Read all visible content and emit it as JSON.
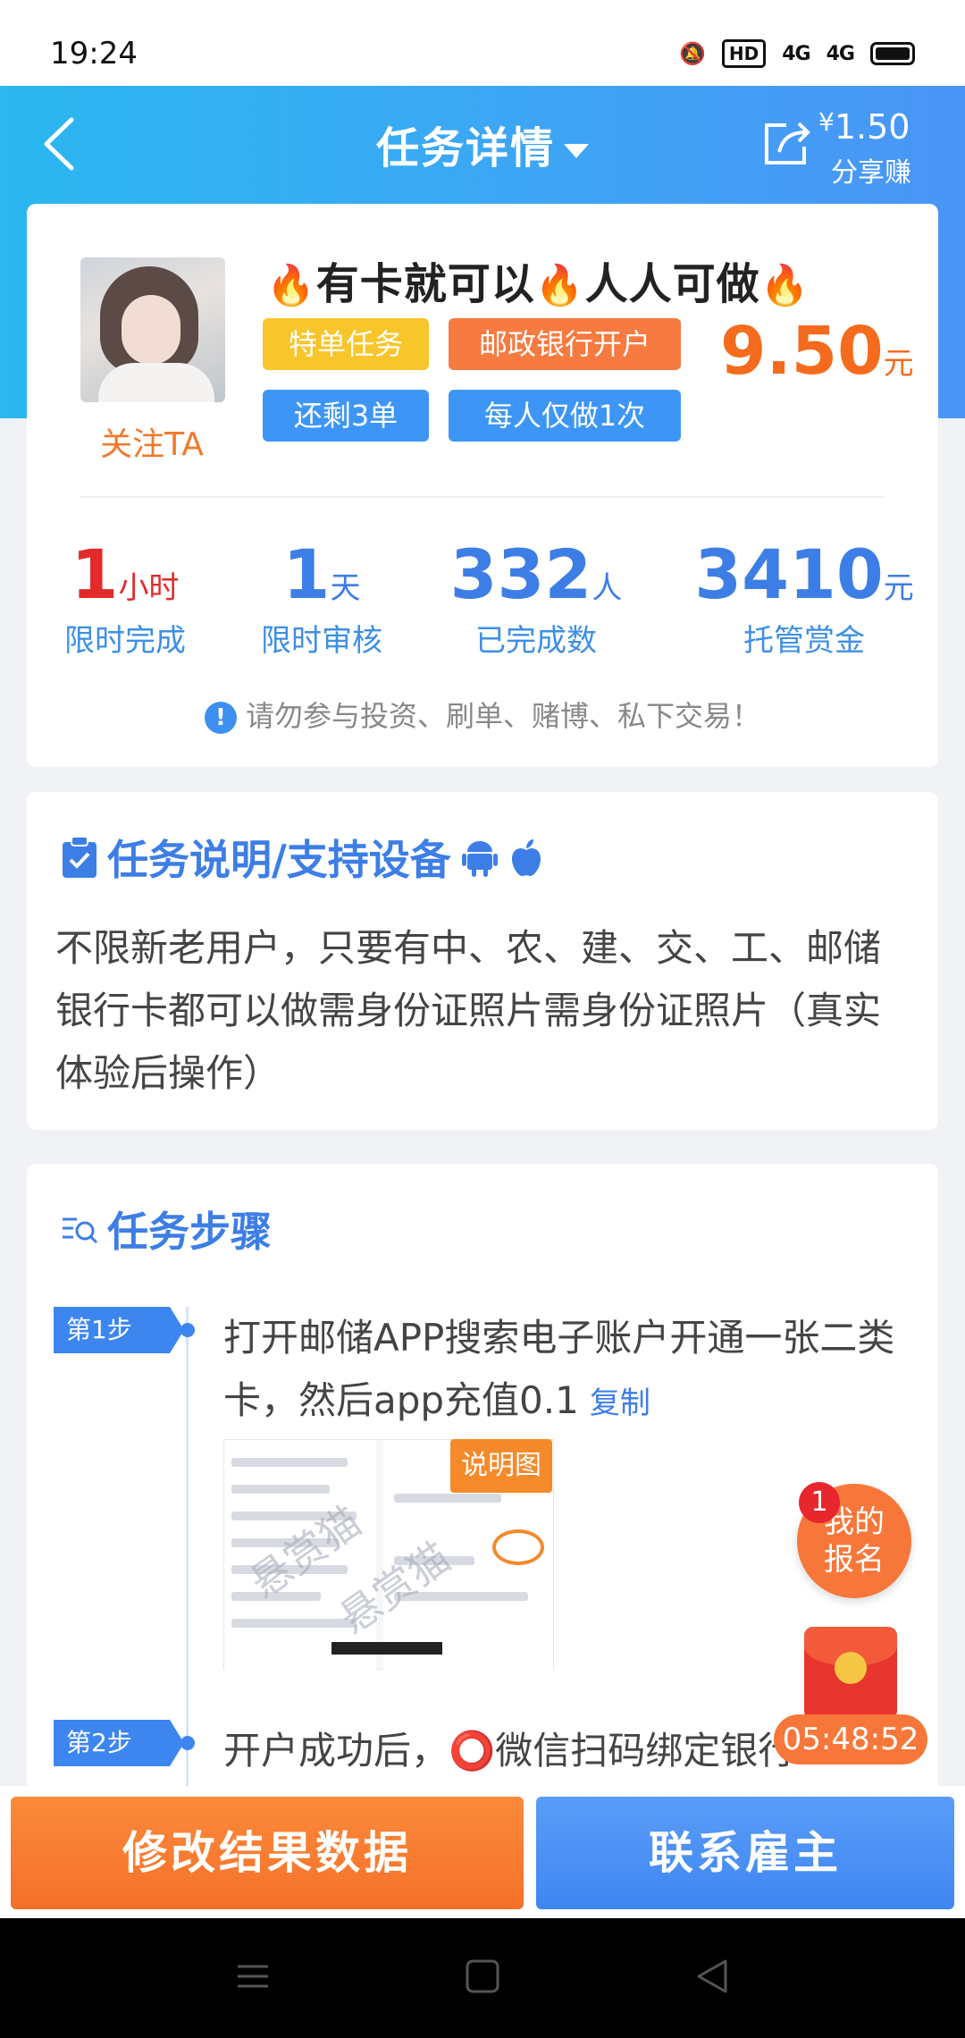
{
  "status_bar": {
    "time": "19:24",
    "hd_label": "HD",
    "net1": "4G",
    "net2": "4G"
  },
  "nav": {
    "title": "任务详情",
    "share_currency": "¥",
    "share_amount": "1.50",
    "share_label": "分享赚"
  },
  "task": {
    "follow_label": "关注TA",
    "title_part1": "有卡就可以",
    "title_part2": "人人可做",
    "tags": [
      "特单任务",
      "邮政银行开户",
      "还剩3单",
      "每人仅做1次"
    ],
    "price": "9.50",
    "price_unit": "元",
    "stats": [
      {
        "value": "1",
        "unit": "小时",
        "label": "限时完成"
      },
      {
        "value": "1",
        "unit": "天",
        "label": "限时审核"
      },
      {
        "value": "332",
        "unit": "人",
        "label": "已完成数"
      },
      {
        "value": "3410",
        "unit": "元",
        "label": "托管赏金"
      }
    ],
    "warning": "请勿参与投资、刷单、赌博、私下交易！"
  },
  "description": {
    "title": "任务说明/支持设备",
    "text": "不限新老用户，只要有中、农、建、交、工、邮储银行卡都可以做需身份证照片需身份证照片（真实体验后操作）"
  },
  "steps": {
    "title": "任务步骤",
    "items": [
      {
        "badge": "第1步",
        "text": "打开邮储APP搜索电子账户开通一张二类卡，然后app充值0.1",
        "copy": "复制"
      },
      {
        "badge": "第2步",
        "text": "开户成功后，⭕微信扫码绑定银行"
      }
    ],
    "screenshot_label": "说明图",
    "screenshot_watermark": "悬赏猫"
  },
  "floating": {
    "my_signup_line1": "我的",
    "my_signup_line2": "报名",
    "badge_count": "1",
    "timer": "05:48:52"
  },
  "actions": {
    "left_button": "修改结果数据",
    "right_button": "联系雇主"
  },
  "colors": {
    "primary_blue": "#3d7ee6",
    "accent_orange": "#f5702a",
    "header_start": "#2bb7f0",
    "header_end": "#4a95f6"
  }
}
